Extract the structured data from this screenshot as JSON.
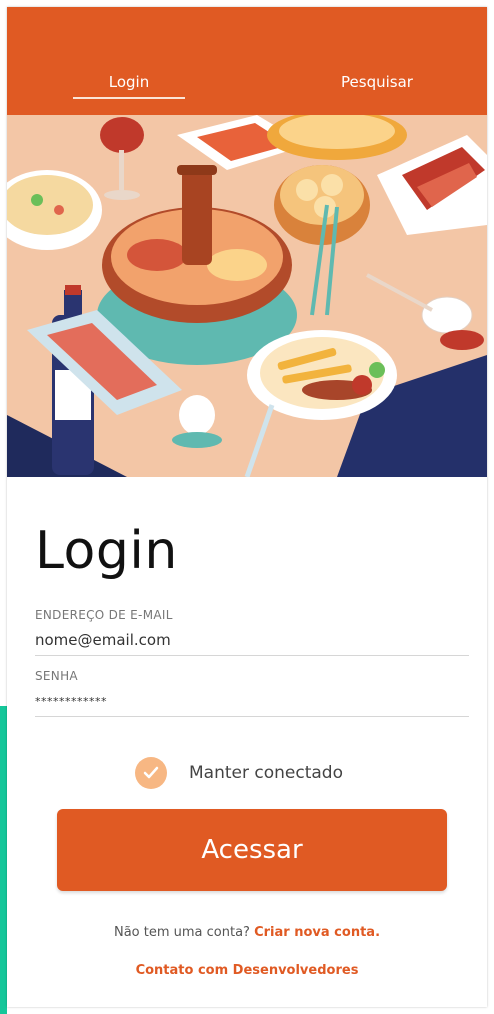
{
  "nav": {
    "tab_login": "Login",
    "tab_search": "Pesquisar"
  },
  "colors": {
    "brand": "#e05a23",
    "accent_left": "#15c79a",
    "checkbox": "#f7b783"
  },
  "form": {
    "title": "Login",
    "email_label": "ENDEREÇO DE E-MAIL",
    "email_value": "nome@email.com",
    "password_label": "SENHA",
    "password_value": "************",
    "remember_label": "Manter conectado",
    "remember_checked": true,
    "submit_label": "Acessar"
  },
  "footer": {
    "signup_prompt": "Não tem uma conta?",
    "signup_link": "Criar nova conta.",
    "contact_link": "Contato com Desenvolvedores"
  },
  "icons": {
    "check": "check-icon"
  }
}
